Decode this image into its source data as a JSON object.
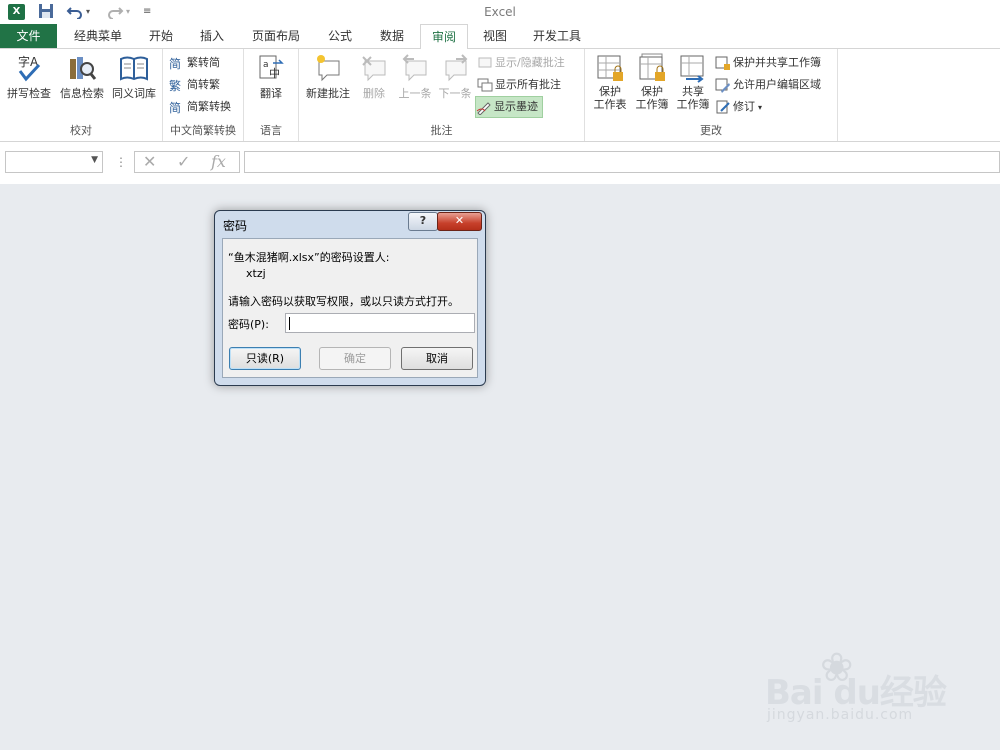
{
  "app": {
    "title": "Excel",
    "logo_text": "X"
  },
  "quick_access": {
    "save_icon": "save-icon",
    "undo_icon": "undo-icon",
    "redo_icon": "redo-icon",
    "customize_icon": "customize-icon"
  },
  "tabs": [
    {
      "label": "文件"
    },
    {
      "label": "经典菜单"
    },
    {
      "label": "开始"
    },
    {
      "label": "插入"
    },
    {
      "label": "页面布局"
    },
    {
      "label": "公式"
    },
    {
      "label": "数据"
    },
    {
      "label": "审阅"
    },
    {
      "label": "视图"
    },
    {
      "label": "开发工具"
    }
  ],
  "ribbon": {
    "proofing": {
      "label": "校对",
      "spelling": "拼写检查",
      "research": "信息检索",
      "thesaurus": "同义词库"
    },
    "chinese": {
      "label": "中文简繁转换",
      "to_simplified": "繁转简",
      "to_traditional": "简转繁",
      "convert": "简繁转换"
    },
    "language": {
      "label": "语言",
      "translate": "翻译"
    },
    "comments": {
      "label": "批注",
      "new": "新建批注",
      "delete": "删除",
      "previous": "上一条",
      "next": "下一条",
      "show_hide": "显示/隐藏批注",
      "show_all": "显示所有批注",
      "show_ink": "显示墨迹"
    },
    "changes": {
      "label": "更改",
      "protect_sheet": "保护\n工作表",
      "protect_workbook": "保护\n工作簿",
      "share_workbook": "共享\n工作簿",
      "protect_share": "保护并共享工作簿",
      "allow_edit": "允许用户编辑区域",
      "track": "修订"
    }
  },
  "formula_bar": {
    "cancel": "✕",
    "enter": "✓",
    "fx": "fx"
  },
  "dialog": {
    "title": "密码",
    "help": "?",
    "close": "✕",
    "line1": "“鱼木混猪啊.xlsx”的密码设置人:",
    "owner": "xtzj",
    "line2": "请输入密码以获取写权限，或以只读方式打开。",
    "password_label": "密码(P):",
    "btn_readonly": "只读(R)",
    "btn_ok": "确定",
    "btn_cancel": "取消"
  },
  "watermark": {
    "brand": "Bai du经验",
    "url": "jingyan.baidu.com"
  }
}
